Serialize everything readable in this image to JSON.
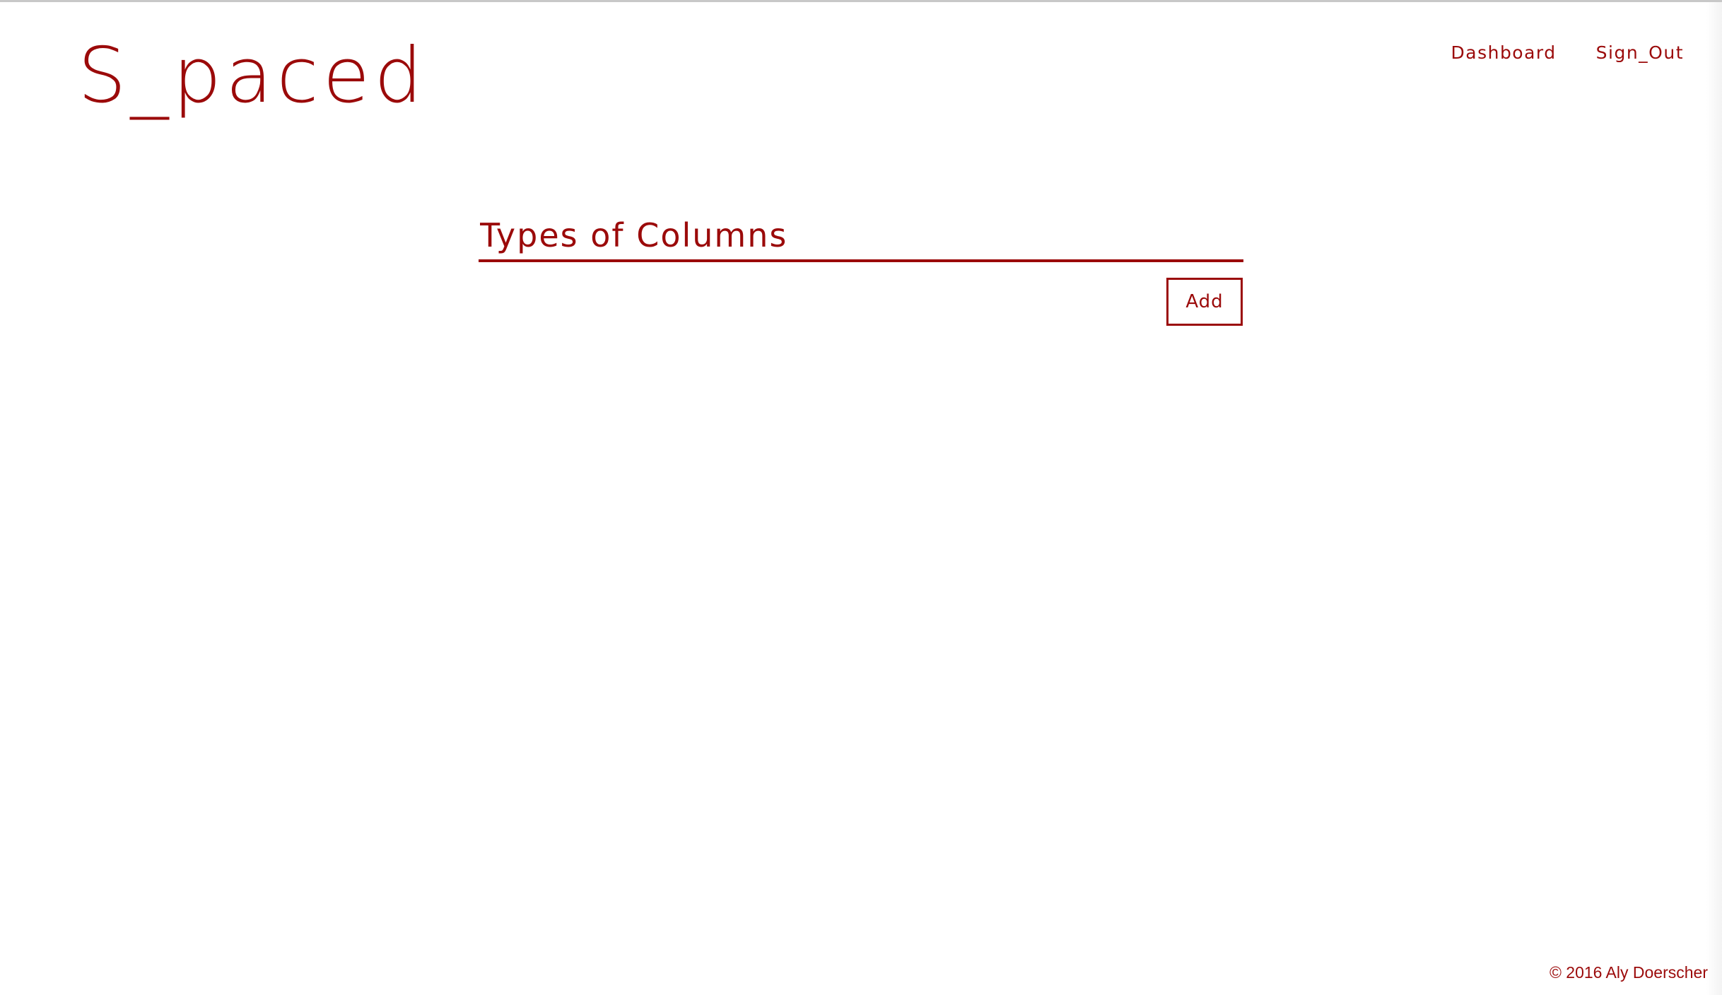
{
  "header": {
    "logo": "S_paced",
    "nav": {
      "dashboard_label": "Dashboard",
      "sign_out_label": "Sign_Out"
    }
  },
  "form": {
    "topic_value": "Types of Columns",
    "add_label": "Add"
  },
  "footer": {
    "copyright": "© 2016 Aly Doerscher"
  },
  "colors": {
    "accent": "#9b0a0a",
    "background": "#ffffff"
  }
}
